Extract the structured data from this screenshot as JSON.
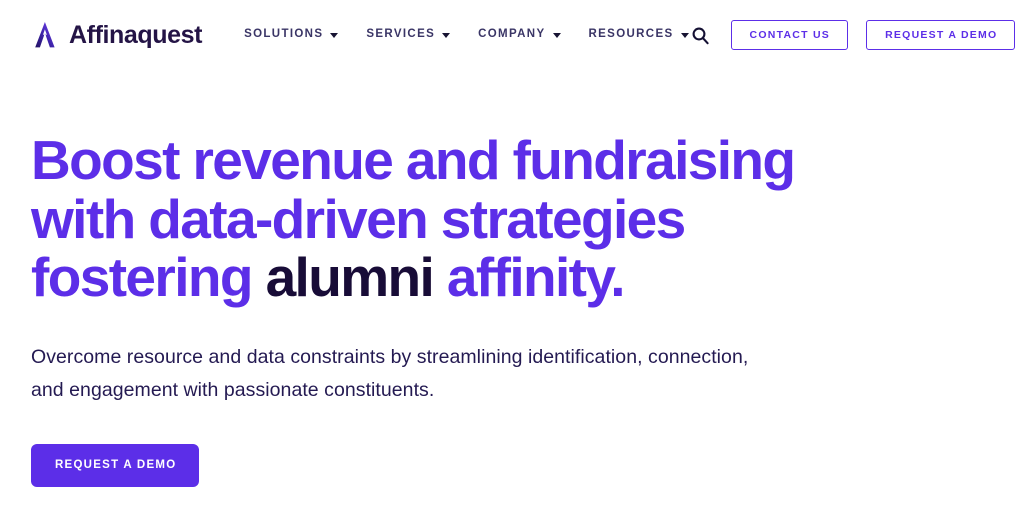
{
  "brand": {
    "name": "Affinaquest",
    "logo_icon": "affinaquest-a-mark-icon",
    "logo_gradient_from": "#2a1b6e",
    "logo_gradient_to": "#6f3cf5",
    "wordmark_color": "#241446"
  },
  "nav": {
    "items": [
      {
        "label": "SOLUTIONS",
        "has_dropdown": true,
        "caret_icon": "chevron-down-icon"
      },
      {
        "label": "SERVICES",
        "has_dropdown": true,
        "caret_icon": "chevron-down-icon"
      },
      {
        "label": "COMPANY",
        "has_dropdown": true,
        "caret_icon": "chevron-down-icon"
      },
      {
        "label": "RESOURCES",
        "has_dropdown": true,
        "caret_icon": "chevron-down-icon"
      }
    ],
    "link_color": "#3a3566"
  },
  "header_actions": {
    "search_icon": "search-icon",
    "contact_label": "CONTACT US",
    "demo_label": "REQUEST A DEMO"
  },
  "hero": {
    "title_line1": "Boost revenue and fundraising",
    "title_line2": "with data-driven strategies",
    "title_line3_part1": "fostering ",
    "title_line3_highlight": "alumni",
    "title_line3_part2": " affinity.",
    "subtitle_line1": "Overcome resource and data constraints by streamlining identification, connection,",
    "subtitle_line2": "and engagement with passionate constituents.",
    "cta_label": "REQUEST A DEMO"
  },
  "colors": {
    "accent_purple": "#5c2ee8",
    "dark_navy": "#180c37",
    "body_text": "#241a52",
    "background": "#ffffff"
  }
}
